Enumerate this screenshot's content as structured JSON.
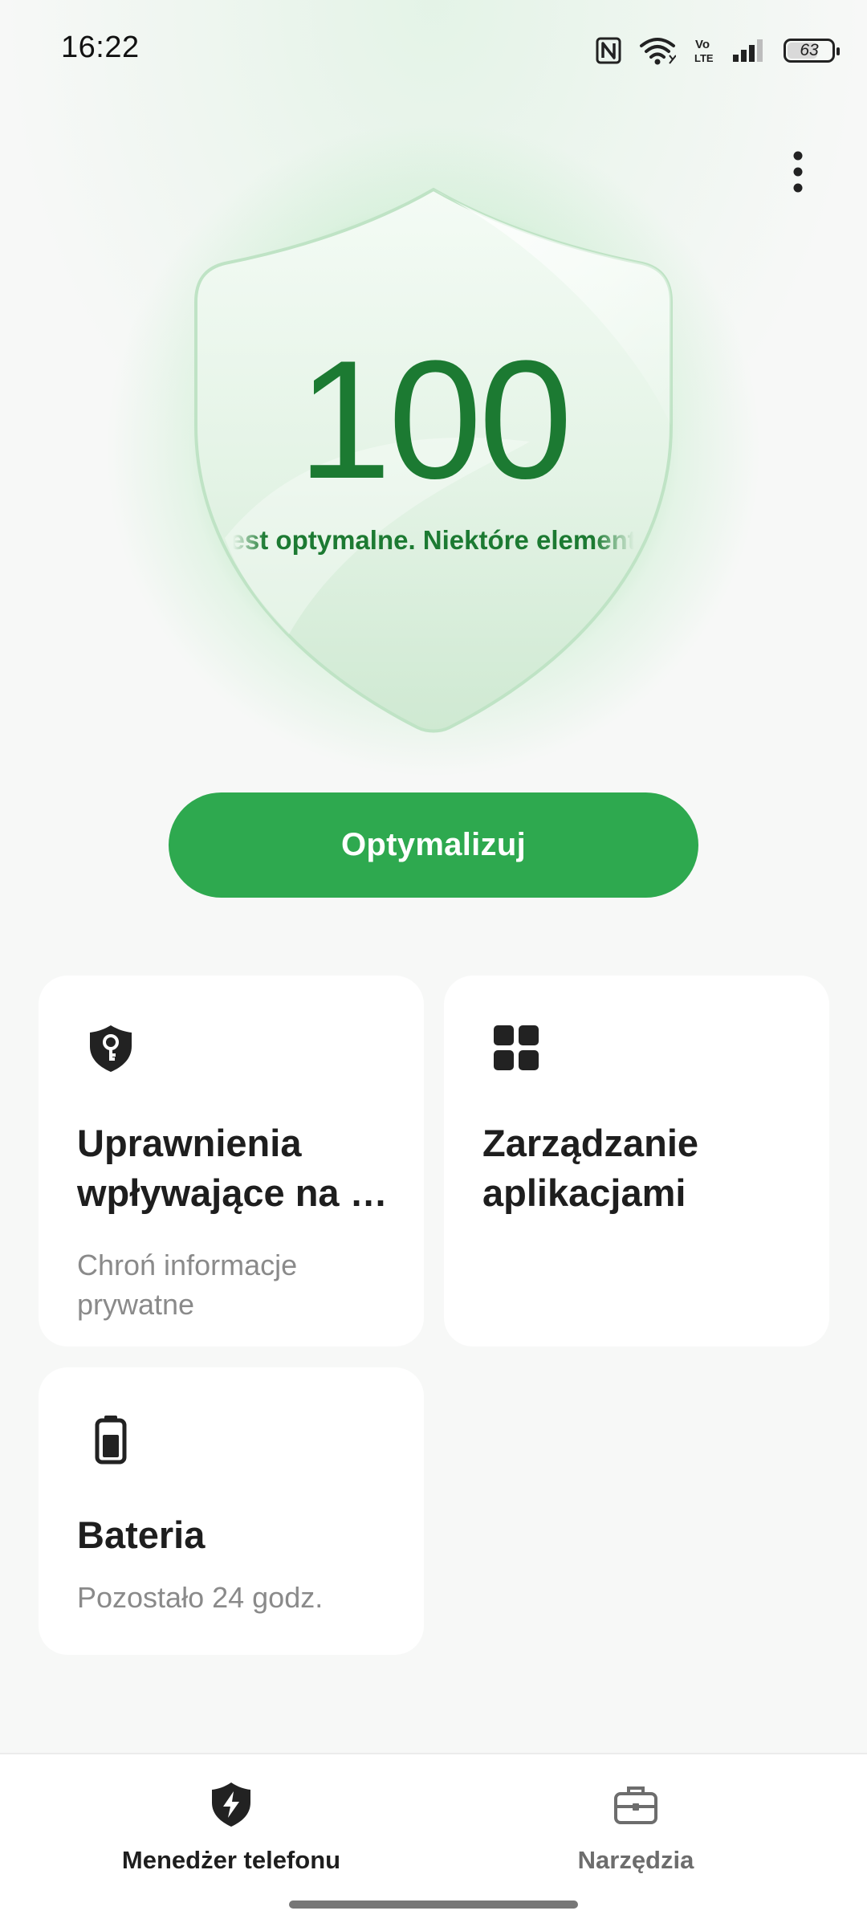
{
  "status_bar": {
    "time": "16:22",
    "icons": [
      "nfc-icon",
      "wifi-icon",
      "volte-icon",
      "signal-icon"
    ],
    "volte_label": "Vo LTE",
    "battery_level": "63"
  },
  "hero": {
    "score": "100",
    "status_text": "Urządzenie jest optymalne. Niektóre elementy",
    "optimize_label": "Optymalizuj",
    "accent_color": "#2ea94f",
    "score_color": "#1c7a32"
  },
  "cards": [
    {
      "icon": "shield-key-icon",
      "title": "Uprawnienia wpływające na …",
      "subtitle": "Chroń informacje prywatne"
    },
    {
      "icon": "app-grid-icon",
      "title": "Zarządzanie aplikacjami",
      "subtitle": ""
    },
    {
      "icon": "battery-icon",
      "title": "Bateria",
      "subtitle": "Pozostało 24 godz."
    }
  ],
  "bottom_nav": [
    {
      "icon": "shield-bolt-icon",
      "label": "Menedżer telefonu",
      "active": true
    },
    {
      "icon": "toolbox-icon",
      "label": "Narzędzia",
      "active": false
    }
  ]
}
